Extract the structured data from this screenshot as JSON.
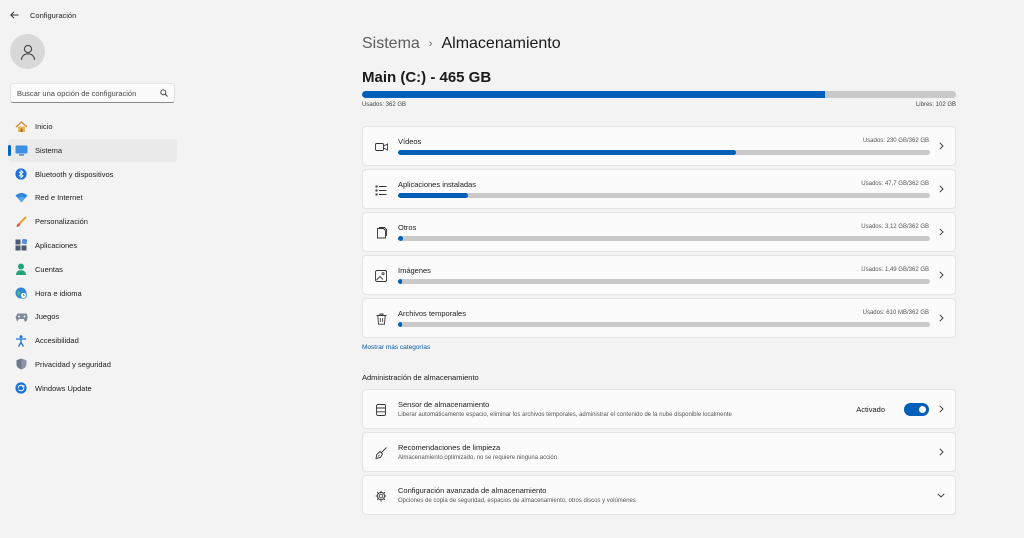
{
  "window": {
    "title": "Configuración"
  },
  "sidebar": {
    "search_placeholder": "Buscar una opción de configuración",
    "items": [
      {
        "label": "Inicio",
        "icon": "home-icon",
        "active": false
      },
      {
        "label": "Sistema",
        "icon": "monitor-icon",
        "active": true
      },
      {
        "label": "Bluetooth y dispositivos",
        "icon": "bluetooth-icon",
        "active": false
      },
      {
        "label": "Red e Internet",
        "icon": "wifi-icon",
        "active": false
      },
      {
        "label": "Personalización",
        "icon": "brush-icon",
        "active": false
      },
      {
        "label": "Aplicaciones",
        "icon": "apps-icon",
        "active": false
      },
      {
        "label": "Cuentas",
        "icon": "person-icon",
        "active": false
      },
      {
        "label": "Hora e idioma",
        "icon": "globe-clock-icon",
        "active": false
      },
      {
        "label": "Juegos",
        "icon": "gamepad-icon",
        "active": false
      },
      {
        "label": "Accesibilidad",
        "icon": "accessibility-icon",
        "active": false
      },
      {
        "label": "Privacidad y seguridad",
        "icon": "shield-icon",
        "active": false
      },
      {
        "label": "Windows Update",
        "icon": "update-icon",
        "active": false
      }
    ]
  },
  "breadcrumb": {
    "parent": "Sistema",
    "separator": "›",
    "current": "Almacenamiento"
  },
  "drive": {
    "title": "Main (C:) - 465 GB",
    "used_label": "Usados: 362 GB",
    "free_label": "Libres: 102 GB",
    "used_fraction": 0.78
  },
  "categories": [
    {
      "label": "Vídeos",
      "usage": "Usados: 230 GB/362 GB",
      "fraction": 0.635,
      "icon": "video-icon"
    },
    {
      "label": "Aplicaciones instaladas",
      "usage": "Usados: 47,7 GB/362 GB",
      "fraction": 0.132,
      "icon": "apps-list-icon"
    },
    {
      "label": "Otros",
      "usage": "Usados: 3,12 GB/362 GB",
      "fraction": 0.009,
      "icon": "document-icon"
    },
    {
      "label": "Imágenes",
      "usage": "Usados: 1,49 GB/362 GB",
      "fraction": 0.004,
      "icon": "image-icon"
    },
    {
      "label": "Archivos temporales",
      "usage": "Usados: 610 MB/362 GB",
      "fraction": 0.002,
      "icon": "trash-icon"
    }
  ],
  "more_link": "Mostrar más categorías",
  "management": {
    "title": "Administración de almacenamiento",
    "sensor": {
      "title": "Sensor de almacenamiento",
      "desc": "Liberar automáticamente espacio, eliminar los archivos temporales, administrar el contenido de la nube disponible localmente",
      "state_label": "Activado",
      "on": true
    },
    "cleanup": {
      "title": "Recomendaciones de limpieza",
      "desc": "Almacenamiento optimizado, no se requiere ninguna acción"
    },
    "advanced": {
      "title": "Configuración avanzada de almacenamiento",
      "desc": "Opciones de copia de seguridad, espacios de almacenamiento, otros discos y volúmenes"
    }
  },
  "colors": {
    "accent": "#005fb8",
    "track": "#c9c9c9",
    "background": "#f3f3f3",
    "card": "#fbfbfb"
  }
}
